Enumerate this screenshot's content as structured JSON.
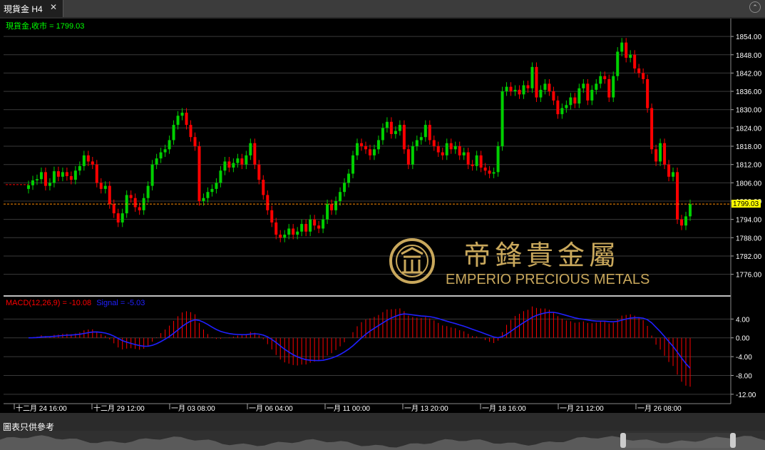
{
  "tab": {
    "title": "現貨金 H4",
    "close_glyph": "✕"
  },
  "collapse_glyph": "⌃",
  "footer": {
    "disclaimer": "圖表只供參考"
  },
  "watermark": {
    "cn": "帝鋒貴金屬",
    "en": "EMPERIO PRECIOUS METALS"
  },
  "colors": {
    "up": "#00d000",
    "down": "#ff0000",
    "macd": "#ff0000",
    "signal": "#2020ff",
    "axis_text": "#ffffff",
    "grid": "#3a3a3a",
    "price_line": "#ff8c00",
    "label_bg": "#ffff00",
    "legend_price": "#00ff00",
    "gold": "#c9a85c"
  },
  "chart_data": {
    "type": "candlestick",
    "legend": "現貨金,收市 = 1799.03",
    "last_price": 1799.03,
    "last_price_label": "1799.03",
    "price_axis": {
      "ylim": [
        1771,
        1858
      ],
      "ticks": [
        "1854.00",
        "1848.00",
        "1842.00",
        "1836.00",
        "1830.00",
        "1824.00",
        "1818.00",
        "1812.00",
        "1806.00",
        "1800.00",
        "1794.00",
        "1788.00",
        "1782.00",
        "1776.00"
      ]
    },
    "time_axis": {
      "ticks": [
        "十二月 24 16:00",
        "十二月 29 12:00",
        "一月 03 08:00",
        "一月 06 04:00",
        "一月 11 00:00",
        "一月 13 20:00",
        "一月 18 16:00",
        "一月 21 12:00",
        "一月 26 08:00"
      ]
    },
    "close": [
      1805.2,
      1806.8,
      1807.2,
      1809.5,
      1805.0,
      1806.0,
      1809.8,
      1808.0,
      1809.5,
      1808.2,
      1807.0,
      1810.0,
      1811.5,
      1815.0,
      1813.0,
      1812.0,
      1806.0,
      1804.0,
      1805.0,
      1799.0,
      1796.0,
      1793.0,
      1796.0,
      1802.0,
      1801.0,
      1798.0,
      1797.0,
      1801.0,
      1805.0,
      1812.0,
      1814.0,
      1816.0,
      1817.0,
      1820.0,
      1825.0,
      1828.0,
      1829.0,
      1825.0,
      1821.0,
      1818.0,
      1800.0,
      1801.0,
      1803.0,
      1804.0,
      1806.0,
      1810.0,
      1813.0,
      1811.0,
      1812.5,
      1814.0,
      1812.0,
      1815.0,
      1819.0,
      1812.0,
      1807.0,
      1802.0,
      1797.0,
      1793.0,
      1789.0,
      1788.0,
      1789.0,
      1791.0,
      1789.0,
      1790.0,
      1792.5,
      1790.0,
      1794.0,
      1792.0,
      1791.0,
      1794.0,
      1799.0,
      1797.0,
      1800.0,
      1803.0,
      1806.0,
      1809.0,
      1815.0,
      1819.0,
      1818.0,
      1817.0,
      1815.0,
      1817.0,
      1820.0,
      1824.0,
      1826.0,
      1822.0,
      1823.0,
      1825.0,
      1817.0,
      1812.0,
      1818.0,
      1820.0,
      1821.0,
      1825.0,
      1820.0,
      1818.0,
      1816.0,
      1815.0,
      1819.0,
      1817.0,
      1818.0,
      1815.0,
      1816.0,
      1812.0,
      1811.5,
      1815.0,
      1811.0,
      1810.0,
      1809.0,
      1809.5,
      1818.0,
      1836.0,
      1837.5,
      1836.0,
      1836.5,
      1835.0,
      1838.0,
      1837.0,
      1844.0,
      1834.0,
      1836.5,
      1838.5,
      1836.0,
      1833.0,
      1828.5,
      1830.5,
      1831.5,
      1834.0,
      1832.0,
      1837.0,
      1838.5,
      1833.0,
      1836.5,
      1838.5,
      1841.0,
      1840.0,
      1834.0,
      1841.0,
      1849.0,
      1852.0,
      1847.0,
      1848.0,
      1843.5,
      1842.0,
      1840.0,
      1830.5,
      1817.0,
      1813.0,
      1819.0,
      1812.0,
      1808.0,
      1809.5,
      1794.0,
      1792.0,
      1795.0,
      1799.0
    ]
  }
}
